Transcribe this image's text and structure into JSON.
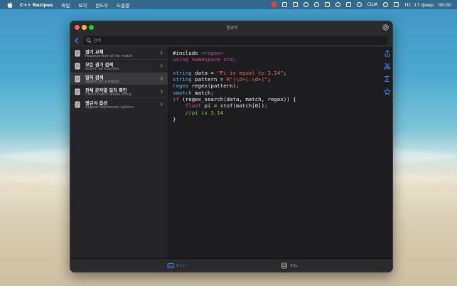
{
  "menubar": {
    "app_name": "C++ Recipes",
    "items": [
      "파일",
      "보기",
      "윈도우",
      "도움말"
    ],
    "input_source": "США",
    "datetime": "Пт, 17 февр.  09:00"
  },
  "window": {
    "title": "정규식",
    "search": {
      "placeholder": "검색"
    }
  },
  "sidebar": {
    "items": [
      {
        "title": "경기 교체",
        "subtitle": "Replacement of the match"
      },
      {
        "title": "모든 경기 검색",
        "subtitle": "Search all matches"
      },
      {
        "title": "일치 검색",
        "subtitle": "Search for a match",
        "selected": true
      },
      {
        "title": "전체 문자열 일치 확인",
        "subtitle": "Check match whole string"
      },
      {
        "title": "정규식 옵션",
        "subtitle": "Regular expression options"
      }
    ]
  },
  "code": {
    "l1_include": "#include ",
    "l1_header": "<regex>",
    "l2_using": "using namespace std;",
    "l4_type": "string",
    "l4_rest": " data = ",
    "l4_str": "\"Pi is equal to 3.14\"",
    "l4_end": ";",
    "l5_type": "string",
    "l5_rest": " pattern = ",
    "l5_r": "R",
    "l5_str": "\"(\\d+\\.\\d+)\"",
    "l5_end": ";",
    "l6_type": "regex",
    "l6_rest": " regex(pattern);",
    "l7_type": "smatch",
    "l7_rest": " match;",
    "l8_if": "if",
    "l8_rest": " (regex_search(data, match, regex)) {",
    "l9_float": "float",
    "l9_rest": " pi = stof(match[0]);",
    "l10_comment": "//pi is 3.14",
    "l11_close": "}"
  },
  "tabs": {
    "cpp": "C++",
    "sql": "SQL"
  },
  "colors": {
    "accent": "#3b7ff5",
    "keyword": "#cf4fa4",
    "type": "#5fb2e6",
    "string": "#f16b65",
    "comment": "#8dca57"
  },
  "icons": {
    "toolbar": [
      "share-icon",
      "scissors-icon",
      "sigma-icon",
      "star-icon"
    ]
  }
}
